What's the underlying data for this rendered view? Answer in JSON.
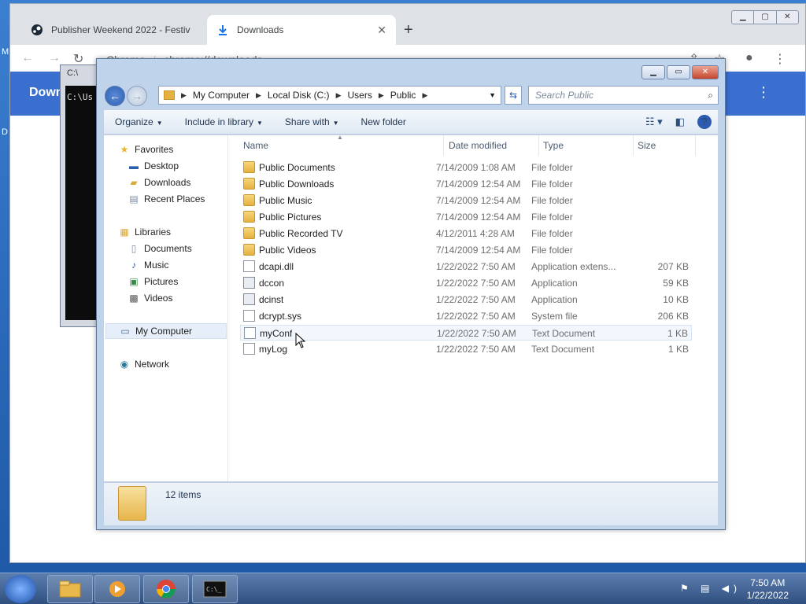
{
  "chrome": {
    "tabs": [
      {
        "label": "Publisher Weekend 2022 - Festiv",
        "icon": "steam-icon"
      },
      {
        "label": "Downloads",
        "icon": "download-icon"
      }
    ],
    "omnibox_origin": "Chrome",
    "omnibox_url": "chrome://downloads",
    "banner_title": "Down"
  },
  "cmd": {
    "title": "C:\\",
    "body": "C:\\Us"
  },
  "explorer": {
    "address": {
      "crumbs": [
        "My Computer",
        "Local Disk (C:)",
        "Users",
        "Public"
      ]
    },
    "search_placeholder": "Search Public",
    "toolbar": {
      "organize": "Organize",
      "include_in_library": "Include in library",
      "share_with": "Share with",
      "new_folder": "New folder"
    },
    "nav": {
      "favorites": "Favorites",
      "desktop": "Desktop",
      "downloads": "Downloads",
      "recent_places": "Recent Places",
      "libraries": "Libraries",
      "documents": "Documents",
      "music": "Music",
      "pictures": "Pictures",
      "videos": "Videos",
      "my_computer": "My Computer",
      "network": "Network"
    },
    "columns": {
      "name": "Name",
      "date_modified": "Date modified",
      "type": "Type",
      "size": "Size"
    },
    "files": [
      {
        "name": "Public Documents",
        "date": "7/14/2009 1:08 AM",
        "type": "File folder",
        "size": "",
        "icon": "folder-icon"
      },
      {
        "name": "Public Downloads",
        "date": "7/14/2009 12:54 AM",
        "type": "File folder",
        "size": "",
        "icon": "folder-icon"
      },
      {
        "name": "Public Music",
        "date": "7/14/2009 12:54 AM",
        "type": "File folder",
        "size": "",
        "icon": "folder-icon"
      },
      {
        "name": "Public Pictures",
        "date": "7/14/2009 12:54 AM",
        "type": "File folder",
        "size": "",
        "icon": "folder-icon"
      },
      {
        "name": "Public Recorded TV",
        "date": "4/12/2011 4:28 AM",
        "type": "File folder",
        "size": "",
        "icon": "folder-icon"
      },
      {
        "name": "Public Videos",
        "date": "7/14/2009 12:54 AM",
        "type": "File folder",
        "size": "",
        "icon": "folder-icon"
      },
      {
        "name": "dcapi.dll",
        "date": "1/22/2022 7:50 AM",
        "type": "Application extens...",
        "size": "207 KB",
        "icon": "dll-icon"
      },
      {
        "name": "dccon",
        "date": "1/22/2022 7:50 AM",
        "type": "Application",
        "size": "59 KB",
        "icon": "app-icon"
      },
      {
        "name": "dcinst",
        "date": "1/22/2022 7:50 AM",
        "type": "Application",
        "size": "10 KB",
        "icon": "app-icon"
      },
      {
        "name": "dcrypt.sys",
        "date": "1/22/2022 7:50 AM",
        "type": "System file",
        "size": "206 KB",
        "icon": "dll-icon"
      },
      {
        "name": "myConf",
        "date": "1/22/2022 7:50 AM",
        "type": "Text Document",
        "size": "1 KB",
        "icon": "file-icon"
      },
      {
        "name": "myLog",
        "date": "1/22/2022 7:50 AM",
        "type": "Text Document",
        "size": "1 KB",
        "icon": "file-icon"
      }
    ],
    "status": "12 items"
  },
  "taskbar": {
    "time": "7:50 AM",
    "date": "1/22/2022"
  }
}
